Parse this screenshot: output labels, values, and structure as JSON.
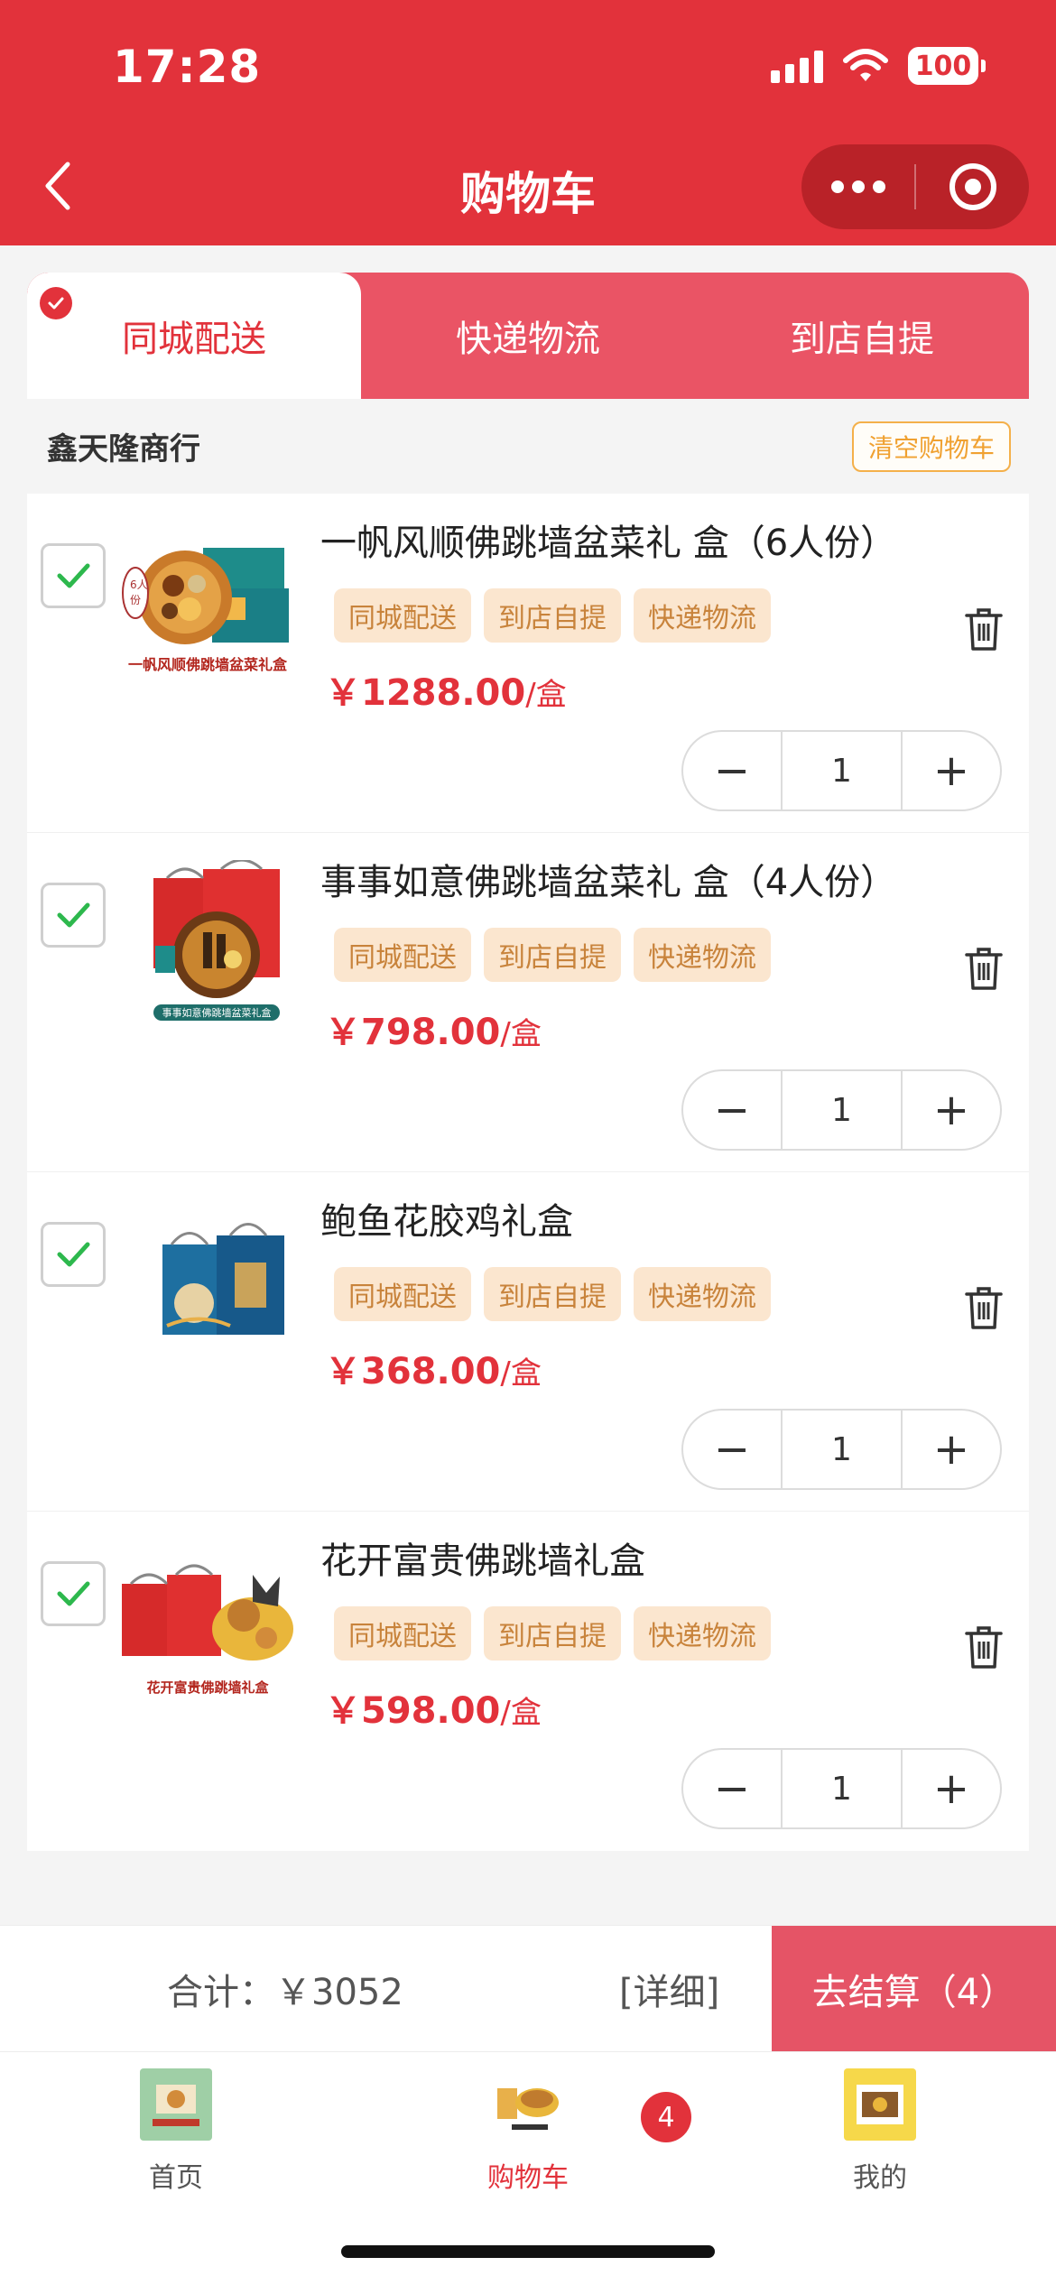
{
  "status": {
    "time": "17:28",
    "battery": "100"
  },
  "nav": {
    "title": "购物车"
  },
  "tabs": [
    {
      "label": "同城配送"
    },
    {
      "label": "快递物流"
    },
    {
      "label": "到店自提"
    }
  ],
  "store": {
    "name": "鑫天隆商行",
    "clear_label": "清空购物车"
  },
  "items": [
    {
      "title": "一帆风顺佛跳墙盆菜礼 盒（6人份）",
      "tags": [
        "同城配送",
        "到店自提",
        "快递物流"
      ],
      "price": "￥1288.00",
      "unit": "/盒",
      "qty": "1",
      "minus": "−",
      "plus": "+",
      "image_caption": "一帆风顺佛跳墙盆菜礼盒"
    },
    {
      "title": "事事如意佛跳墙盆菜礼 盒（4人份）",
      "tags": [
        "同城配送",
        "到店自提",
        "快递物流"
      ],
      "price": "￥798.00",
      "unit": "/盒",
      "qty": "1",
      "minus": "−",
      "plus": "+",
      "image_caption": "事事如意佛跳墙盆菜礼盒"
    },
    {
      "title": "鲍鱼花胶鸡礼盒",
      "tags": [
        "同城配送",
        "到店自提",
        "快递物流"
      ],
      "price": "￥368.00",
      "unit": "/盒",
      "qty": "1",
      "minus": "−",
      "plus": "+",
      "image_caption": ""
    },
    {
      "title": "花开富贵佛跳墙礼盒",
      "tags": [
        "同城配送",
        "到店自提",
        "快递物流"
      ],
      "price": "￥598.00",
      "unit": "/盒",
      "qty": "1",
      "minus": "−",
      "plus": "+",
      "image_caption": "花开富贵佛跳墙礼盒"
    }
  ],
  "checkout": {
    "total": "合计：￥3052",
    "detail": "[详细]",
    "pay_label": "去结算（4）"
  },
  "tabbar": {
    "items": [
      {
        "label": "首页"
      },
      {
        "label": "购物车"
      },
      {
        "label": "我的"
      }
    ],
    "badge": "4"
  },
  "colors": {
    "primary": "#e2323b",
    "tab_bg": "#ea5465",
    "tag_bg": "#fbe6cf",
    "tag_text": "#c8833b",
    "check": "#2db84d"
  }
}
